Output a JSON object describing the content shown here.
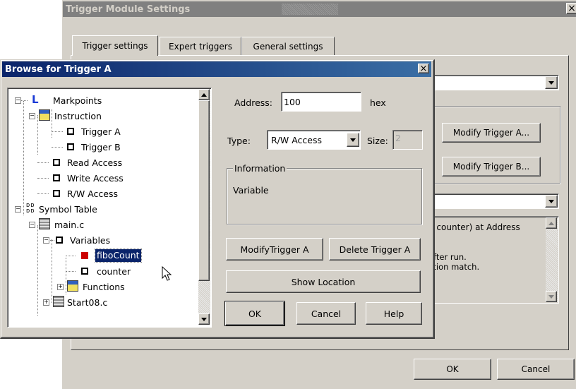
{
  "main_dialog": {
    "title": "Trigger Module Settings",
    "close_glyph": "×",
    "tabs": [
      {
        "label": "Trigger settings",
        "active": true
      },
      {
        "label": "Expert triggers",
        "active": false
      },
      {
        "label": "General settings",
        "active": false
      }
    ],
    "modify_trigger_a_label": "Modify Trigger A...",
    "modify_trigger_b_label": "Modify Trigger B...",
    "info_text_partial": "n counter) at Address",
    "info_line2_partial": "after run.",
    "info_line3_partial": "lition match.",
    "ok_label": "OK",
    "cancel_label": "Cancel"
  },
  "browse_dialog": {
    "title": "Browse for Trigger A",
    "close_glyph": "×",
    "tree": [
      {
        "label": "Markpoints",
        "icon": "markpoint-icon"
      },
      {
        "label": "Instruction",
        "icon": "instruction-icon"
      },
      {
        "label": "Trigger A",
        "icon": "leaf-icon"
      },
      {
        "label": "Trigger B",
        "icon": "leaf-icon"
      },
      {
        "label": "Read Access",
        "icon": "leaf-icon"
      },
      {
        "label": "Write Access",
        "icon": "leaf-icon"
      },
      {
        "label": "R/W Access",
        "icon": "leaf-icon"
      },
      {
        "label": "Symbol Table",
        "icon": "symbol-table-icon"
      },
      {
        "label": "main.c",
        "icon": "source-file-icon"
      },
      {
        "label": "Variables",
        "icon": "leaf-icon"
      },
      {
        "label": "fiboCount",
        "icon": "leaf-icon",
        "selected": true
      },
      {
        "label": "counter",
        "icon": "leaf-icon"
      },
      {
        "label": "Functions",
        "icon": "functions-icon"
      },
      {
        "label": "Start08.c",
        "icon": "source-file-icon"
      }
    ],
    "address_label": "Address:",
    "address_value": "100",
    "address_unit": "hex",
    "type_label": "Type:",
    "type_value": "R/W Access",
    "size_label": "Size:",
    "size_value": "2",
    "information_label": "Information",
    "information_text": "Variable",
    "modify_trigger_label": "ModifyTrigger A",
    "delete_trigger_label": "Delete Trigger A",
    "show_location_label": "Show Location",
    "ok_label": "OK",
    "cancel_label": "Cancel",
    "help_label": "Help"
  },
  "colors": {
    "face": "#d4d0c8",
    "active_title": "#0a246a",
    "inactive_title": "#808080",
    "selection": "#0a246a"
  }
}
